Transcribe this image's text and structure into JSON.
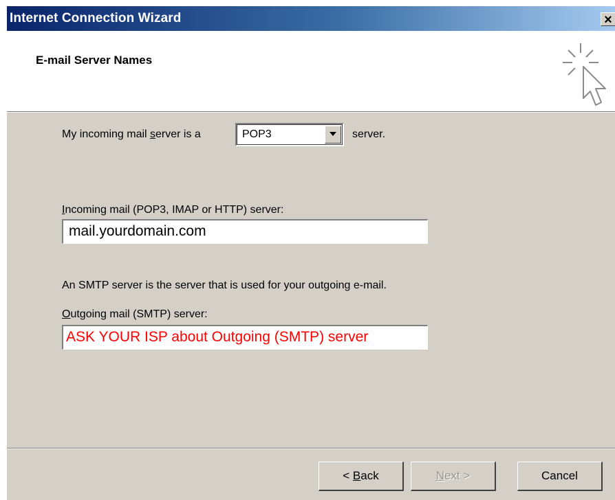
{
  "window": {
    "title": "Internet Connection Wizard",
    "close_glyph": "×"
  },
  "header": {
    "title": "E-mail Server Names",
    "icon": "wizard-cursor-sparkle-icon"
  },
  "incoming_type": {
    "prefix": "My incoming mail ",
    "prefix_accel": "s",
    "prefix_rest": "erver is a",
    "selected": "POP3",
    "suffix": "server."
  },
  "incoming_server": {
    "label_accel": "I",
    "label_rest": "ncoming mail (POP3, IMAP or HTTP) server:",
    "value": "mail.yourdomain.com"
  },
  "smtp_info": "An SMTP server is the server that is used for your outgoing e-mail.",
  "outgoing_server": {
    "label_accel": "O",
    "label_rest": "utgoing mail (SMTP) server:",
    "value": "ASK YOUR ISP about Outgoing (SMTP) server",
    "value_color": "#ff0000"
  },
  "buttons": {
    "back_prefix": "< ",
    "back_accel": "B",
    "back_rest": "ack",
    "next_accel": "N",
    "next_rest": "ext >",
    "cancel": "Cancel"
  }
}
